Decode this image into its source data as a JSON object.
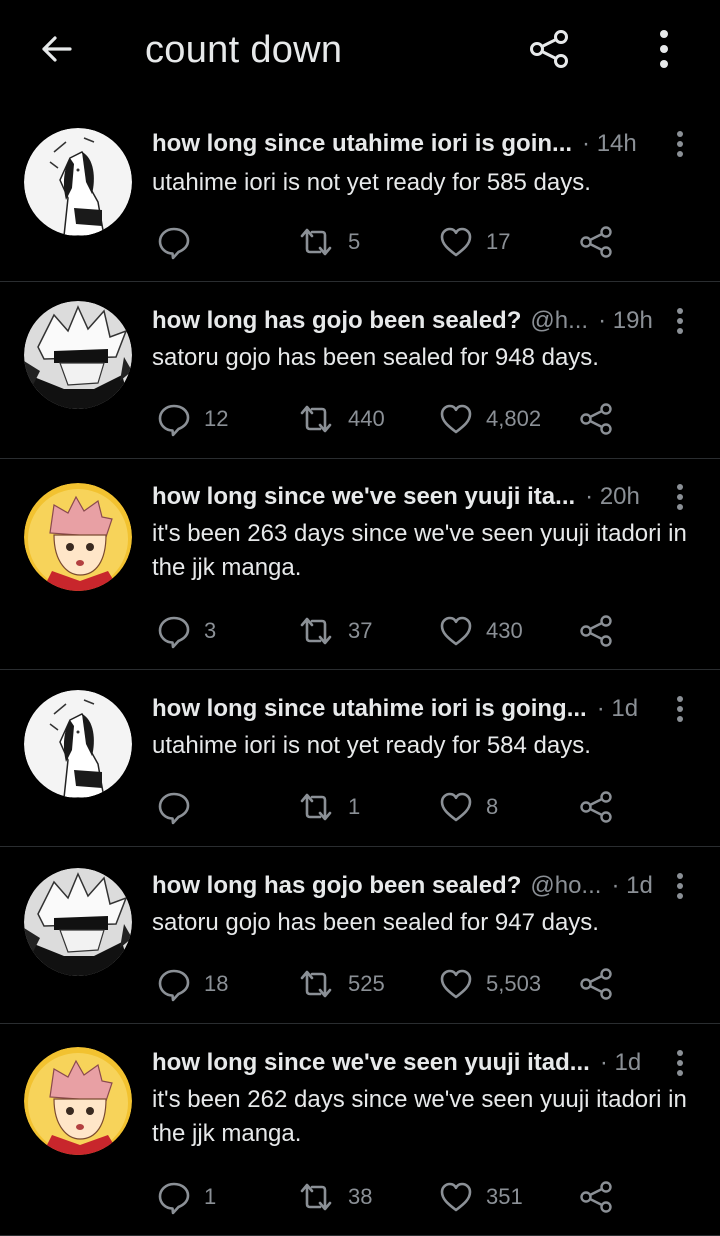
{
  "header": {
    "title": "count down",
    "back_icon": "arrow-left-icon",
    "share_icon": "share-icon",
    "more_icon": "more-vertical-icon"
  },
  "tweets": [
    {
      "avatar": "utahime",
      "name": "how long since utahime iori is goin...",
      "handle": "",
      "time": "· 14h",
      "text": "utahime iori is not yet ready for 585 days.",
      "replies": "",
      "retweets": "5",
      "likes": "17"
    },
    {
      "avatar": "gojo",
      "name": "how long has gojo been sealed?",
      "handle": "@h...",
      "time": "· 19h",
      "text": "satoru gojo has been sealed for 948 days.",
      "replies": "12",
      "retweets": "440",
      "likes": "4,802"
    },
    {
      "avatar": "yuuji",
      "name": "how long since we've seen yuuji ita...",
      "handle": "",
      "time": "· 20h",
      "text": "it's been 263 days since we've seen yuuji itadori in the jjk manga.",
      "replies": "3",
      "retweets": "37",
      "likes": "430"
    },
    {
      "avatar": "utahime",
      "name": "how long since utahime iori is going...",
      "handle": "",
      "time": "· 1d",
      "text": "utahime iori is not yet ready for 584 days.",
      "replies": "",
      "retweets": "1",
      "likes": "8"
    },
    {
      "avatar": "gojo",
      "name": "how long has gojo been sealed?",
      "handle": "@ho...",
      "time": "· 1d",
      "text": "satoru gojo has been sealed for 947 days.",
      "replies": "18",
      "retweets": "525",
      "likes": "5,503"
    },
    {
      "avatar": "yuuji",
      "name": "how long since we've seen yuuji itad...",
      "handle": "",
      "time": "· 1d",
      "text": "it's been 262 days since we've seen yuuji itadori in the jjk manga.",
      "replies": "1",
      "retweets": "38",
      "likes": "351"
    }
  ],
  "colors": {
    "background": "#000000",
    "text": "#e7e9ea",
    "muted": "#8b9096",
    "divider": "#2a2d30"
  }
}
